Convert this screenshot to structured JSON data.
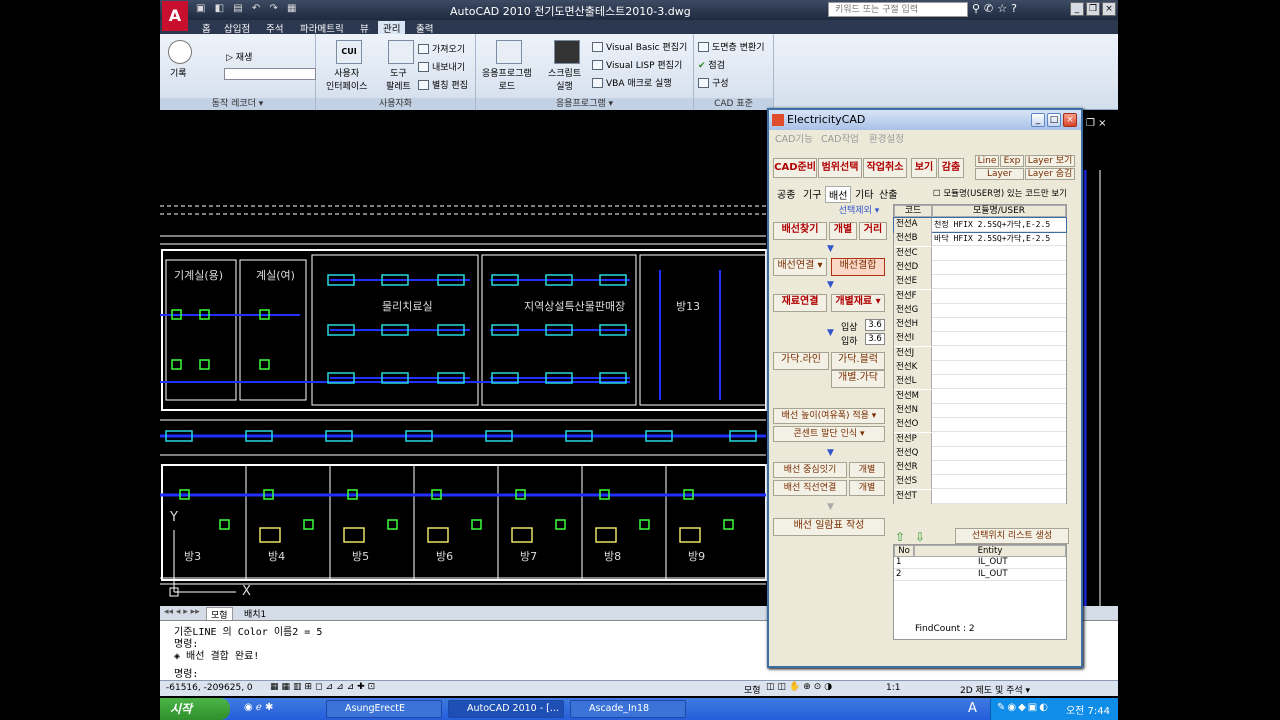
{
  "app": {
    "title": "AutoCAD 2010   전기도면산출테스트2010-3.dwg",
    "logo_letter": "A",
    "search_placeholder": "키워드 또는 구절 입력",
    "quick_access": "▣ ◧ ▤ ↶ ↷ ▦"
  },
  "ribbon_tabs": [
    "홈",
    "삽입점",
    "주석",
    "파라메트릭",
    "뷰",
    "관리",
    "출력"
  ],
  "ribbon_active_tab": "관리",
  "ribbon": {
    "action_recorder": {
      "record": "기록",
      "play": "재생",
      "title": "동작 레코더 ▾"
    },
    "customize": {
      "cui_icon": "CUI",
      "cui": "사용자\n인터페이스",
      "tool_palette": "도구\n팔레트",
      "import": "가져오기",
      "export": "내보내기",
      "alias": "별칭 편집",
      "title": "사용자화"
    },
    "apps": {
      "load": "응용프로그램\n로드",
      "script": "스크립트\n실행",
      "vb": "Visual Basic 편집기",
      "vlisp": "Visual LISP 편집기",
      "vba": "VBA 매크로 실행",
      "title": "응용프로그램 ▾"
    },
    "cad_standard": {
      "layer_trans": "도면층 변환기",
      "check": "점검",
      "config": "구성",
      "title": "CAD 표준"
    }
  },
  "drawing": {
    "rooms": [
      "기계실(용)",
      "계실(여)",
      "물리치료실",
      "지역상설특산물판매장",
      "방13",
      "방3",
      "방4",
      "방5",
      "방6",
      "방7",
      "방8",
      "방9"
    ],
    "axis_x": "X",
    "axis_y": "Y"
  },
  "layout_tabs": [
    "모형",
    "배치1"
  ],
  "command_lines": [
    "기준LINE 의 Color 이름2 = 5",
    "명령:",
    "◈ 배선 결합 완료!",
    "명령:"
  ],
  "status": {
    "coords": "-61516, -209625, 0",
    "model": "모형",
    "scale": "1:1",
    "workspace": "2D 제도 및 주석 ▾"
  },
  "taskbar": {
    "start": "시작",
    "tasks": [
      "AsungErectE",
      "AutoCAD 2010 - [...",
      "Ascade_In18"
    ],
    "time": "오전 7:44"
  },
  "ecad": {
    "title": "ElectricityCAD",
    "menu": [
      "CAD기능",
      "CAD작업",
      "환경설정"
    ],
    "top_buttons": [
      "CAD준비",
      "범위선택",
      "작업취소",
      "보기",
      "감춤"
    ],
    "layer_buttons": [
      "Line",
      "Exp",
      "Layer 보기",
      "Layer",
      "Layer 숨김"
    ],
    "tabs": [
      "공종",
      "기구",
      "배선",
      "기타",
      "산출"
    ],
    "module_check": "모듈명(USER명) 있는 코드만 보기",
    "select_remove": "선택제외",
    "find": [
      "배선찾기",
      "개별",
      "거리"
    ],
    "connect": "배선연결",
    "combine": "배선결합",
    "material": [
      "재료연결",
      "개별재료"
    ],
    "height_in": "입상",
    "height_out": "입하",
    "height_in_val": "3.6",
    "height_out_val": "3.6",
    "cable": [
      "가닥.라인",
      "가닥.블럭",
      "개별.가닥"
    ],
    "height_apply": "배선 높이(여유폭) 적용",
    "outlet": "콘센트 말단 인식",
    "center": [
      "배선 중심잇기",
      "개별"
    ],
    "straight": [
      "배선 직선연결",
      "개별"
    ],
    "summary": "배선 일람표 작성",
    "grid_headers": [
      "코드",
      "모듈명/USER"
    ],
    "codes": [
      "전선A",
      "전선B",
      "전선C",
      "전선D",
      "전선E",
      "전선F",
      "전선G",
      "전선H",
      "전선I",
      "전선J",
      "전선K",
      "전선L",
      "전선M",
      "전선N",
      "전선O",
      "전선P",
      "전선Q",
      "전선R",
      "전선S",
      "전선T"
    ],
    "code_values": [
      "천정 HFIX 2.5SQ+가닥,E-2.5",
      "바닥 HFIX 2.5SQ+가닥,E-2.5"
    ],
    "list_button": "선택위치 리스트 생성",
    "list_headers": [
      "No",
      "Entity"
    ],
    "list_rows": [
      [
        "1",
        "IL_OUT"
      ],
      [
        "2",
        "IL_OUT"
      ]
    ],
    "find_count": "FindCount : 2"
  }
}
